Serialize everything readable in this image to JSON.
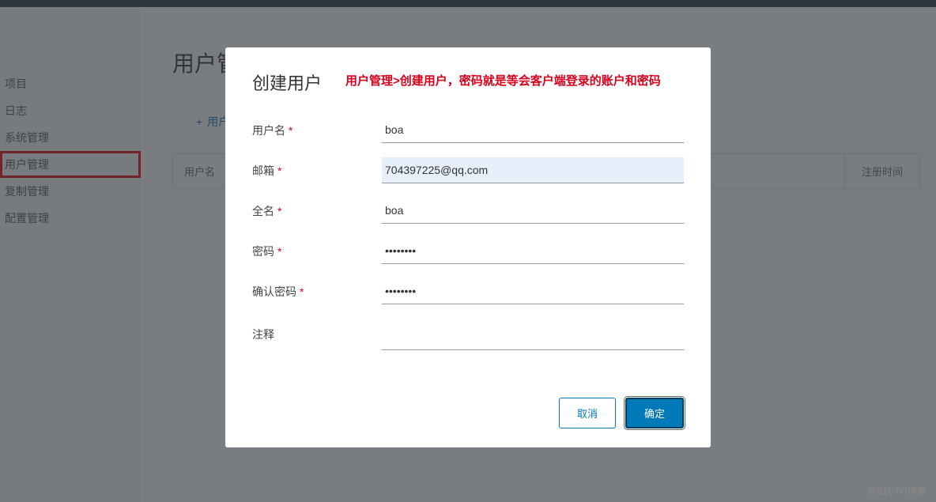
{
  "sidebar": {
    "items": [
      {
        "label": "项目"
      },
      {
        "label": "日志"
      },
      {
        "label": "系统管理"
      },
      {
        "label": "用户管理"
      },
      {
        "label": "复制管理"
      },
      {
        "label": "配置管理"
      }
    ]
  },
  "main": {
    "title": "用户管理",
    "add_user_label": "用户",
    "add_icon": "+",
    "th_username": "用户名",
    "th_regtime": "注册时间"
  },
  "modal": {
    "title": "创建用户",
    "annotation": "用户管理>创建用户，密码就是等会客户端登录的账户和密码",
    "fields": {
      "username": {
        "label": "用户名",
        "required": true,
        "value": "boa"
      },
      "email": {
        "label": "邮箱",
        "required": true,
        "value": "704397225@qq.com"
      },
      "fullname": {
        "label": "全名",
        "required": true,
        "value": "boa"
      },
      "password": {
        "label": "密码",
        "required": true,
        "value": "••••••••"
      },
      "confirm": {
        "label": "确认密码",
        "required": true,
        "value": "••••••••"
      },
      "comment": {
        "label": "注释",
        "required": false,
        "value": ""
      }
    },
    "cancel": "取消",
    "ok": "确定"
  },
  "watermark": "@51CTO博客"
}
